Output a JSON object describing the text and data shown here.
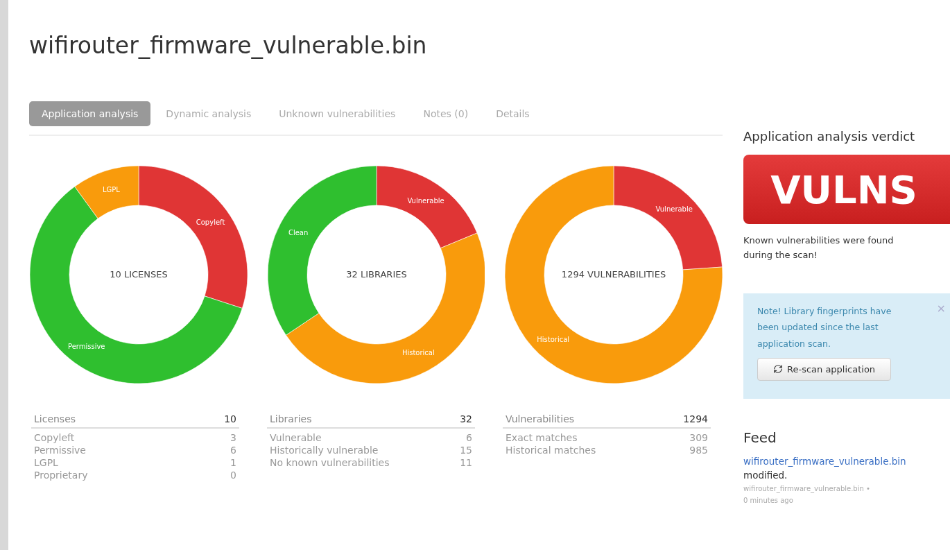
{
  "title": "wifirouter_firmware_vulnerable.bin",
  "tabs": [
    {
      "label": "Application analysis",
      "selected": true
    },
    {
      "label": "Dynamic analysis",
      "selected": false
    },
    {
      "label": "Unknown vulnerabilities",
      "selected": false
    },
    {
      "label": "Notes (0)",
      "selected": false
    },
    {
      "label": "Details",
      "selected": false
    }
  ],
  "charts": [
    {
      "chart_data": {
        "type": "donut",
        "title": "10 LICENSES",
        "categories": [
          "Copyleft",
          "Permissive",
          "LGPL"
        ],
        "values": [
          30,
          60,
          10
        ],
        "colors": [
          "#e03535",
          "#2fbf2f",
          "#f99b0c"
        ]
      }
    },
    {
      "chart_data": {
        "type": "donut",
        "title": "32 LIBRARIES",
        "categories": [
          "Vulnerable",
          "Historical",
          "Clean"
        ],
        "values": [
          18.75,
          46.875,
          34.375
        ],
        "colors": [
          "#e03535",
          "#f99b0c",
          "#2fbf2f"
        ]
      }
    },
    {
      "chart_data": {
        "type": "donut",
        "title": "1294 VULNERABILITIES",
        "categories": [
          "Vulnerable",
          "Historical"
        ],
        "values": [
          23.88,
          76.12
        ],
        "colors": [
          "#e03535",
          "#f99b0c"
        ]
      }
    }
  ],
  "tables": [
    {
      "heading": "Licenses",
      "total": "10",
      "rows": [
        {
          "label": "Copyleft",
          "value": "3"
        },
        {
          "label": "Permissive",
          "value": "6"
        },
        {
          "label": "LGPL",
          "value": "1"
        },
        {
          "label": "Proprietary",
          "value": "0"
        }
      ]
    },
    {
      "heading": "Libraries",
      "total": "32",
      "rows": [
        {
          "label": "Vulnerable",
          "value": "6"
        },
        {
          "label": "Historically vulnerable",
          "value": "15"
        },
        {
          "label": "No known vulnerabilities",
          "value": "11"
        }
      ]
    },
    {
      "heading": "Vulnerabilities",
      "total": "1294",
      "rows": [
        {
          "label": "Exact matches",
          "value": "309"
        },
        {
          "label": "Historical matches",
          "value": "985"
        }
      ]
    }
  ],
  "verdict": {
    "heading": "Application analysis verdict",
    "badge": "VULNS",
    "message": "Known vulnerabilities were found during the scan!"
  },
  "note": {
    "text": "Note! Library fingerprints have been updated since the last application scan.",
    "close": "×",
    "button": "Re-scan application"
  },
  "feed": {
    "heading": "Feed",
    "link": "wifirouter_firmware_vulnerable.bin",
    "action": "modified.",
    "meta": "wifirouter_firmware_vulnerable.bin •",
    "time": "0 minutes ago"
  }
}
